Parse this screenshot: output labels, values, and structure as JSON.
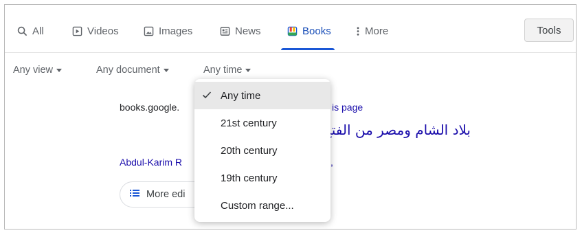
{
  "tabs": [
    {
      "label": "All",
      "icon": "search-icon"
    },
    {
      "label": "Videos",
      "icon": "video-icon"
    },
    {
      "label": "Images",
      "icon": "image-icon"
    },
    {
      "label": "News",
      "icon": "news-icon"
    },
    {
      "label": "Books",
      "icon": "book-icon",
      "active": true
    },
    {
      "label": "More",
      "icon": "more-vert-icon"
    }
  ],
  "tools_label": "Tools",
  "filters": {
    "view": "Any view",
    "document": "Any document",
    "time": "Any time"
  },
  "result": {
    "url": "books.google.",
    "link_suffix": "is page",
    "title": "بلاد الشام ومصر من الفتح ... ن بونابرت ...",
    "author": "Abdul-Karim R",
    "author_suffix": ",",
    "more_editions": "More edi"
  },
  "time_menu": {
    "items": [
      "Any time",
      "21st century",
      "20th century",
      "19th century",
      "Custom range..."
    ],
    "selected": "Any time"
  },
  "colors": {
    "active_tab": "#1a4fb8",
    "link": "#1a0dab",
    "selected_bg": "#e8e8e8"
  }
}
